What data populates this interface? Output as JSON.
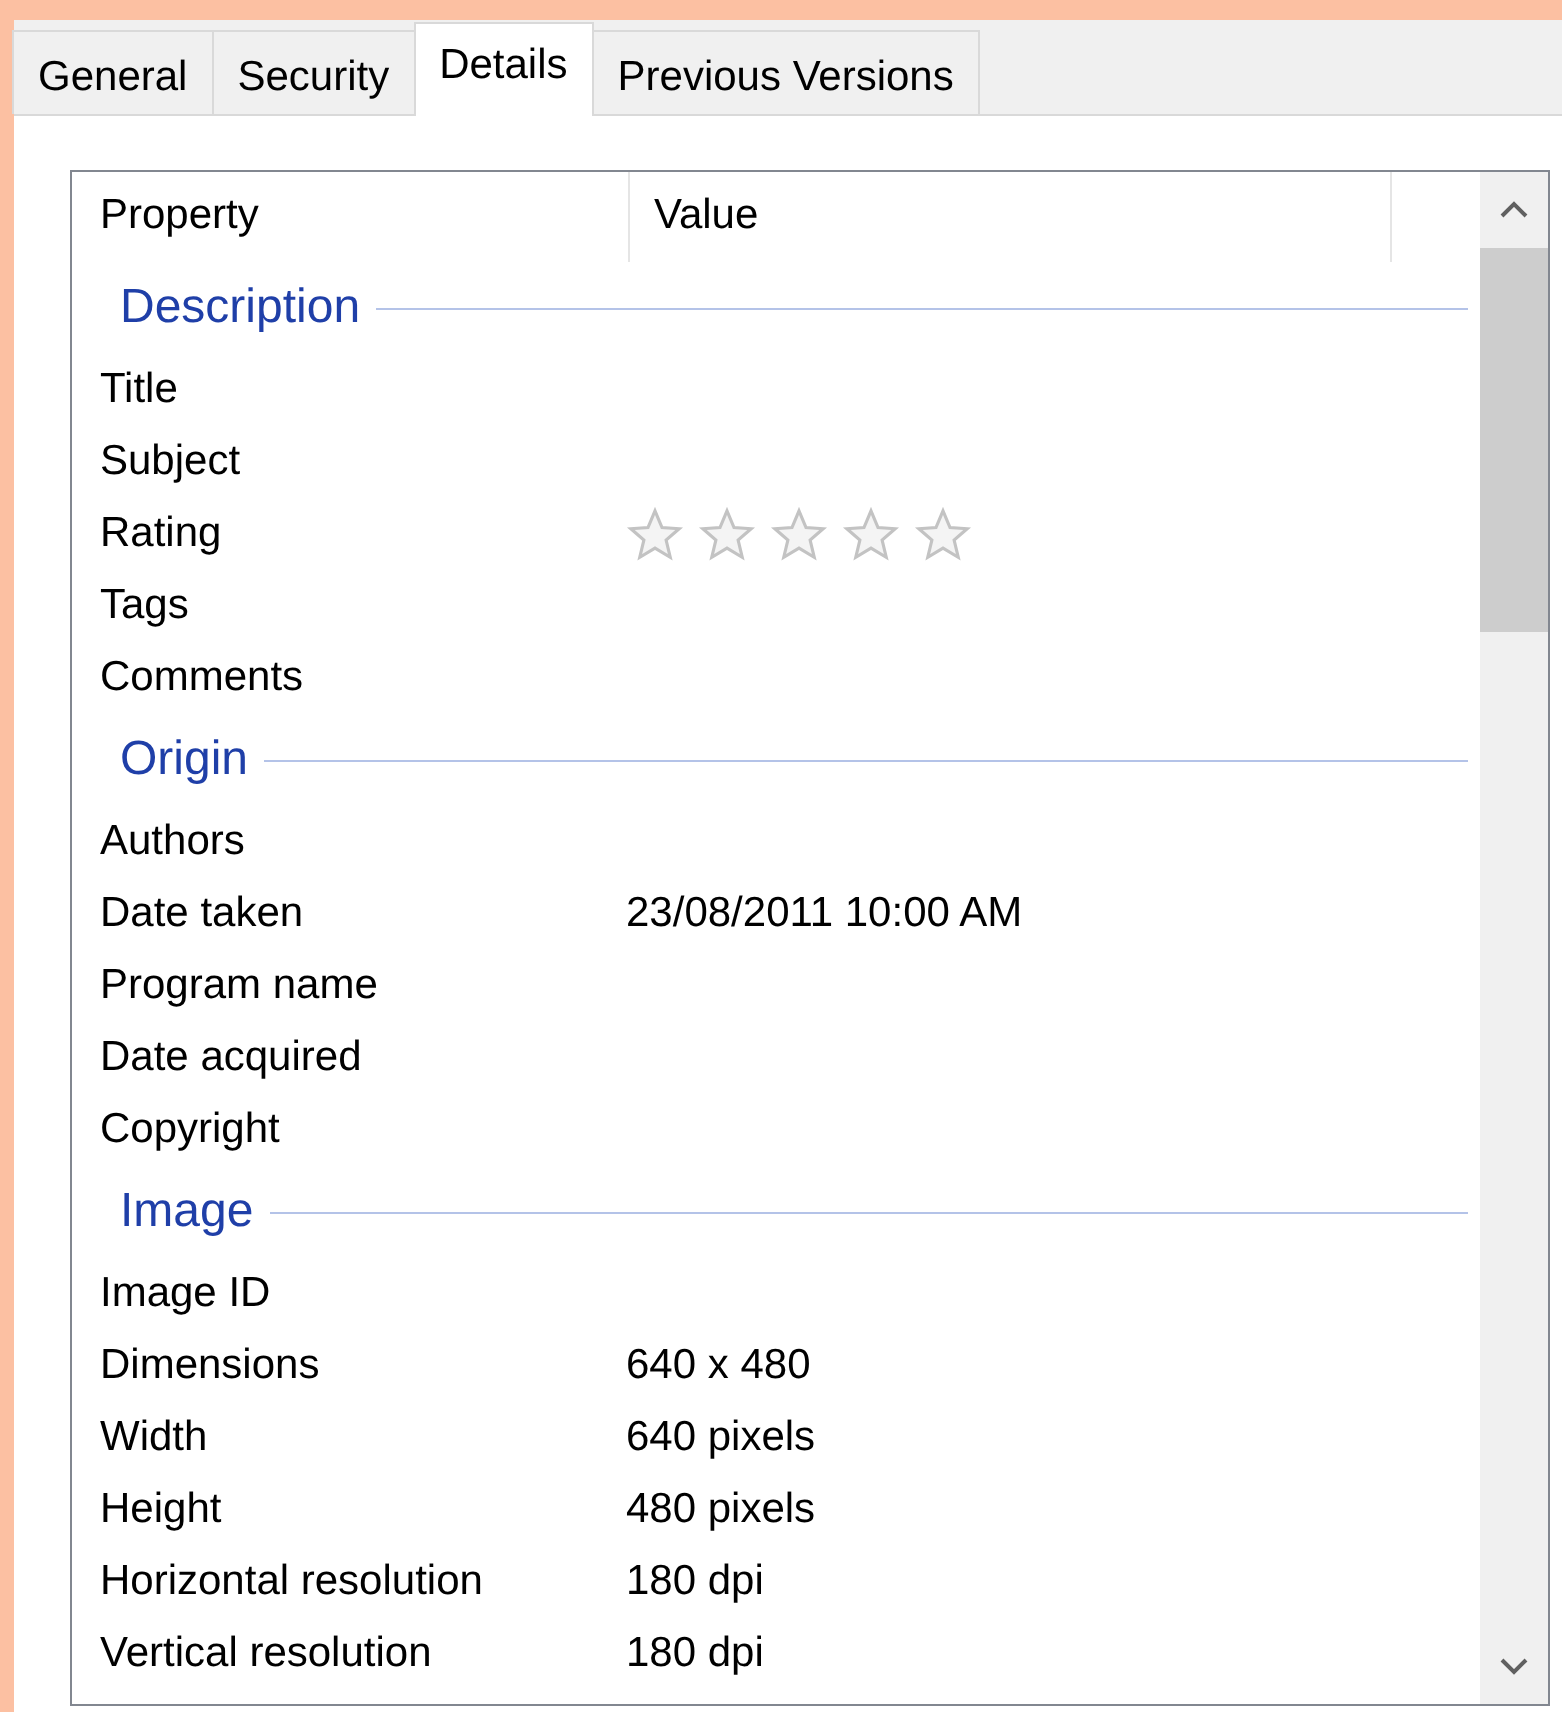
{
  "tabs": [
    {
      "label": "General",
      "selected": false
    },
    {
      "label": "Security",
      "selected": false
    },
    {
      "label": "Details",
      "selected": true
    },
    {
      "label": "Previous Versions",
      "selected": false
    }
  ],
  "table": {
    "columns": [
      "Property",
      "Value"
    ],
    "groups": [
      {
        "title": "Description",
        "rows": [
          {
            "kind": "text",
            "property": "Title"
          },
          {
            "kind": "text",
            "property": "Subject"
          },
          {
            "kind": "rating",
            "property": "Rating",
            "stars": 0
          },
          {
            "kind": "text",
            "property": "Tags"
          },
          {
            "kind": "text",
            "property": "Comments"
          }
        ]
      },
      {
        "title": "Origin",
        "rows": [
          {
            "kind": "text",
            "property": "Authors"
          },
          {
            "kind": "text",
            "property": "Date taken",
            "value": "23/08/2011 10:00 AM"
          },
          {
            "kind": "text",
            "property": "Program name"
          },
          {
            "kind": "text",
            "property": "Date acquired"
          },
          {
            "kind": "text",
            "property": "Copyright"
          }
        ]
      },
      {
        "title": "Image",
        "rows": [
          {
            "kind": "text",
            "property": "Image ID"
          },
          {
            "kind": "text",
            "property": "Dimensions",
            "value": "640 x 480"
          },
          {
            "kind": "text",
            "property": "Width",
            "value": "640 pixels"
          },
          {
            "kind": "text",
            "property": "Height",
            "value": "480 pixels"
          },
          {
            "kind": "text",
            "property": "Horizontal resolution",
            "value": "180 dpi"
          },
          {
            "kind": "text",
            "property": "Vertical resolution",
            "value": "180 dpi"
          }
        ]
      }
    ]
  }
}
